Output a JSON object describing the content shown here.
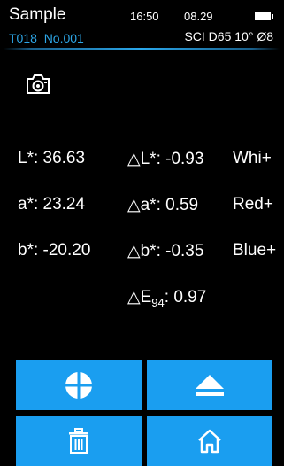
{
  "header": {
    "title": "Sample",
    "time": "16:50",
    "date": "08.29",
    "battery_icon": "battery-icon",
    "sample_id": "T018  No.001",
    "measurement_condition": "SCI D65 10° Ø8"
  },
  "camera_icon": "camera-icon",
  "measurements": {
    "L": "L*: 36.63",
    "a": "a*: 23.24",
    "b": "b*: -20.20",
    "dL": "△L*: -0.93",
    "da": "△a*: 0.59",
    "db": "△b*: -0.35",
    "dL_note": "Whi+",
    "da_note": "Red+",
    "db_note": "Blue+",
    "dE_prefix": "△E",
    "dE_sub": "94",
    "dE_value": ": 0.97"
  },
  "buttons": {
    "measure_icon": "crosshair-icon",
    "eject_icon": "eject-icon",
    "delete_icon": "trash-icon",
    "home_icon": "home-icon"
  },
  "colors": {
    "accent": "#1a9ef0",
    "id_text": "#2da7e8",
    "background": "#000000"
  }
}
